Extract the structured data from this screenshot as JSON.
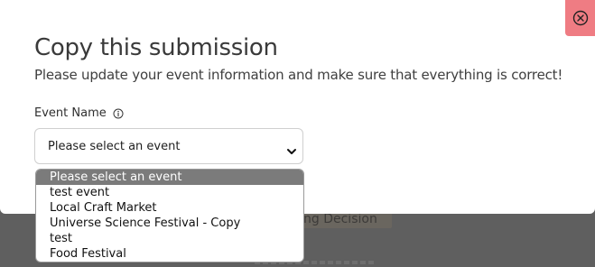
{
  "background": {
    "partial_text": "ng Decision"
  },
  "modal": {
    "title": "Copy this submission",
    "subtitle": "Please update your event information and make sure that everything is correct!",
    "close_icon": "close-circle-icon",
    "event_field": {
      "label": "Event Name",
      "info_icon": "info-circle-icon",
      "selected_value": "Please select an event",
      "options": [
        "Please select an event",
        "test event",
        "Local Craft Market",
        "Universe Science Festival - Copy",
        "test",
        "Food Festival"
      ]
    }
  },
  "colors": {
    "overlay": "#5f5f5f",
    "close_button": "#ef7c83",
    "selected_option": "#7b7b7b"
  }
}
